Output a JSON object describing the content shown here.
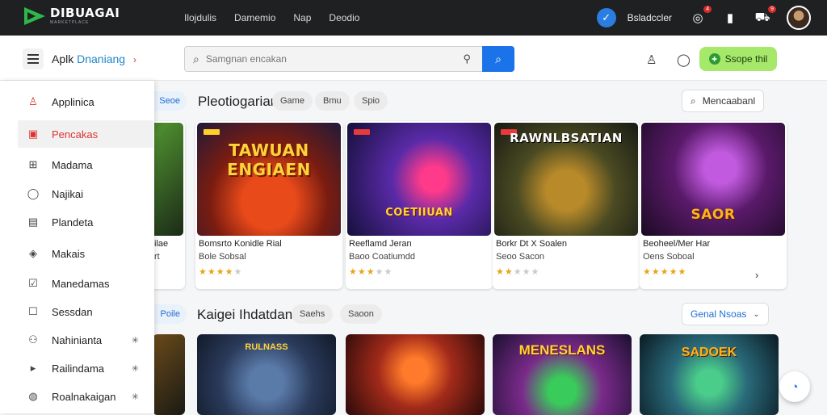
{
  "topbar": {
    "logo_title": "DIBUAGAI",
    "logo_sub": "MARKETPLACE",
    "nav": [
      "Ilojdulis",
      "Damemio",
      "Nap",
      "Deodio"
    ],
    "verified_icon": "check-icon",
    "user_label": "Bsladccler",
    "icons": [
      {
        "name": "gamepad-icon",
        "glyph": "◎",
        "badge": "4"
      },
      {
        "name": "phone-icon",
        "glyph": "▮",
        "badge": ""
      },
      {
        "name": "cart-icon",
        "glyph": "⛟",
        "badge": "9"
      }
    ]
  },
  "subheader": {
    "brand_prefix": "Aplk",
    "brand_name": "Dnaniang",
    "brand_chevron": "›",
    "search_placeholder": "Samgnan encakan",
    "green_button": "Ssope thil",
    "colors": {
      "accent": "#1a73e8",
      "green": "#a5e86a",
      "danger": "#d33333"
    }
  },
  "sidebar": {
    "items": [
      {
        "label": "Applinica",
        "icon": "android-icon",
        "glyph": "♙",
        "trail": ""
      },
      {
        "label": "Pencakas",
        "icon": "folder-icon",
        "glyph": "▣",
        "trail": "",
        "active": true
      },
      {
        "label": "Madama",
        "icon": "grid-icon",
        "glyph": "⊞",
        "trail": ""
      },
      {
        "label": "Najikai",
        "icon": "chat-icon",
        "glyph": "◯",
        "trail": ""
      },
      {
        "label": "Plandeta",
        "icon": "building-icon",
        "glyph": "▤",
        "trail": ""
      },
      {
        "label": "Makais",
        "icon": "tag-icon",
        "glyph": "◈",
        "trail": ""
      },
      {
        "label": "Manedamas",
        "icon": "checklist-icon",
        "glyph": "☑",
        "trail": ""
      },
      {
        "label": "Sessdan",
        "icon": "square-icon",
        "glyph": "☐",
        "trail": ""
      },
      {
        "label": "Nahinianta",
        "icon": "people-icon",
        "glyph": "⚇",
        "trail": "✳"
      },
      {
        "label": "Railindama",
        "icon": "play-icon",
        "glyph": "▸",
        "trail": "✳"
      },
      {
        "label": "Roalnakaigan",
        "icon": "shield-icon",
        "glyph": "◍",
        "trail": "✳"
      }
    ]
  },
  "section1": {
    "side_chip": "Seoe",
    "title": "Pleotiogarian",
    "chips": [
      "Game",
      "Bmu",
      "Spio"
    ],
    "right_label": "Mencaabanl",
    "cards": [
      {
        "art": "TAWUAN ENGIAEN",
        "name": "Bomsrto Konidle Rial",
        "meta": "Bole Sobsal",
        "rating": 4
      },
      {
        "art": "COETIIUAN",
        "name": "Reeflamd Jeran",
        "meta": "Baoo Coatiumdd",
        "rating": 3.5
      },
      {
        "art": "RAWNLBSATIAN",
        "name": "Borkr Dt X Soalen",
        "meta": "Seoo Sacon",
        "rating": 2
      },
      {
        "art": "SAOR",
        "name": "Beoheel/Mer Har",
        "meta": "Oens Soboal",
        "rating": 5
      }
    ],
    "partial_left": {
      "name": "ilae",
      "meta": "rt"
    }
  },
  "section2": {
    "side_chip": "Poile",
    "title": "Kaigei Ihdatdan",
    "chips": [
      "Saehs",
      "Saoon"
    ],
    "right_label": "Genal Nsoas",
    "cards": [
      {
        "art": "RULNASS"
      },
      {
        "art": ""
      },
      {
        "art": "MENESLANS"
      },
      {
        "art": "SADOEK"
      }
    ]
  }
}
